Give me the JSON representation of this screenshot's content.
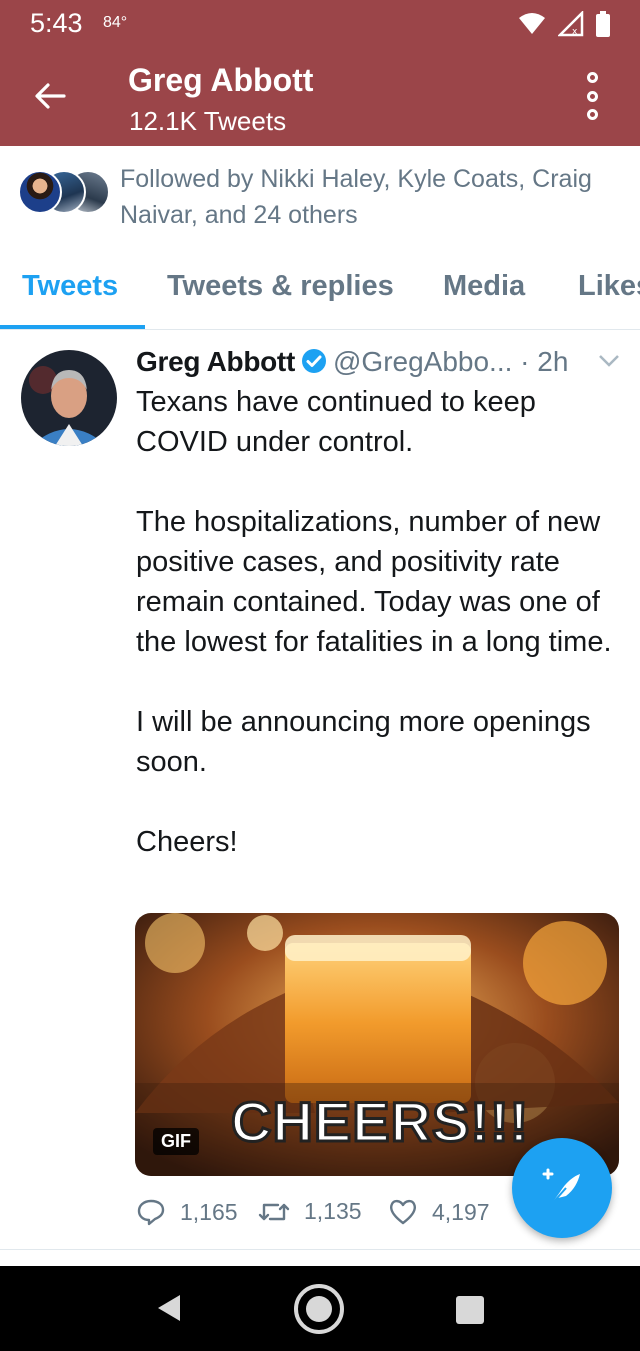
{
  "status_bar": {
    "time": "5:43",
    "temperature": "84°",
    "icons": [
      "wifi-icon",
      "signal-icon",
      "battery-icon"
    ]
  },
  "header": {
    "title": "Greg Abbott",
    "subtitle": "12.1K Tweets",
    "background_color": "#9b4549"
  },
  "followed_by": {
    "text": "Followed by Nikki Haley, Kyle Coats, Craig Naivar, and 24 others"
  },
  "tabs": [
    {
      "label": "Tweets",
      "active": true
    },
    {
      "label": "Tweets & replies",
      "active": false
    },
    {
      "label": "Media",
      "active": false
    },
    {
      "label": "Likes",
      "active": false
    }
  ],
  "tweet": {
    "name": "Greg Abbott",
    "handle": "@GregAbbo...",
    "separator": "·",
    "time": "2h",
    "paragraphs": [
      "Texans have continued to keep COVID under control.",
      "The hospitalizations, number of new positive cases, and positivity rate remain contained. Today was one of the lowest for fatalities in a long time.",
      "I will be announcing more openings soon.",
      "Cheers!"
    ],
    "media": {
      "badge": "GIF",
      "caption": "CHEERS!!!"
    },
    "actions": {
      "replies": "1,165",
      "retweets": "1,135",
      "likes": "4,197"
    }
  },
  "colors": {
    "accent": "#1da1f2",
    "secondary_text": "#657786",
    "verified": "#1da1f2"
  }
}
